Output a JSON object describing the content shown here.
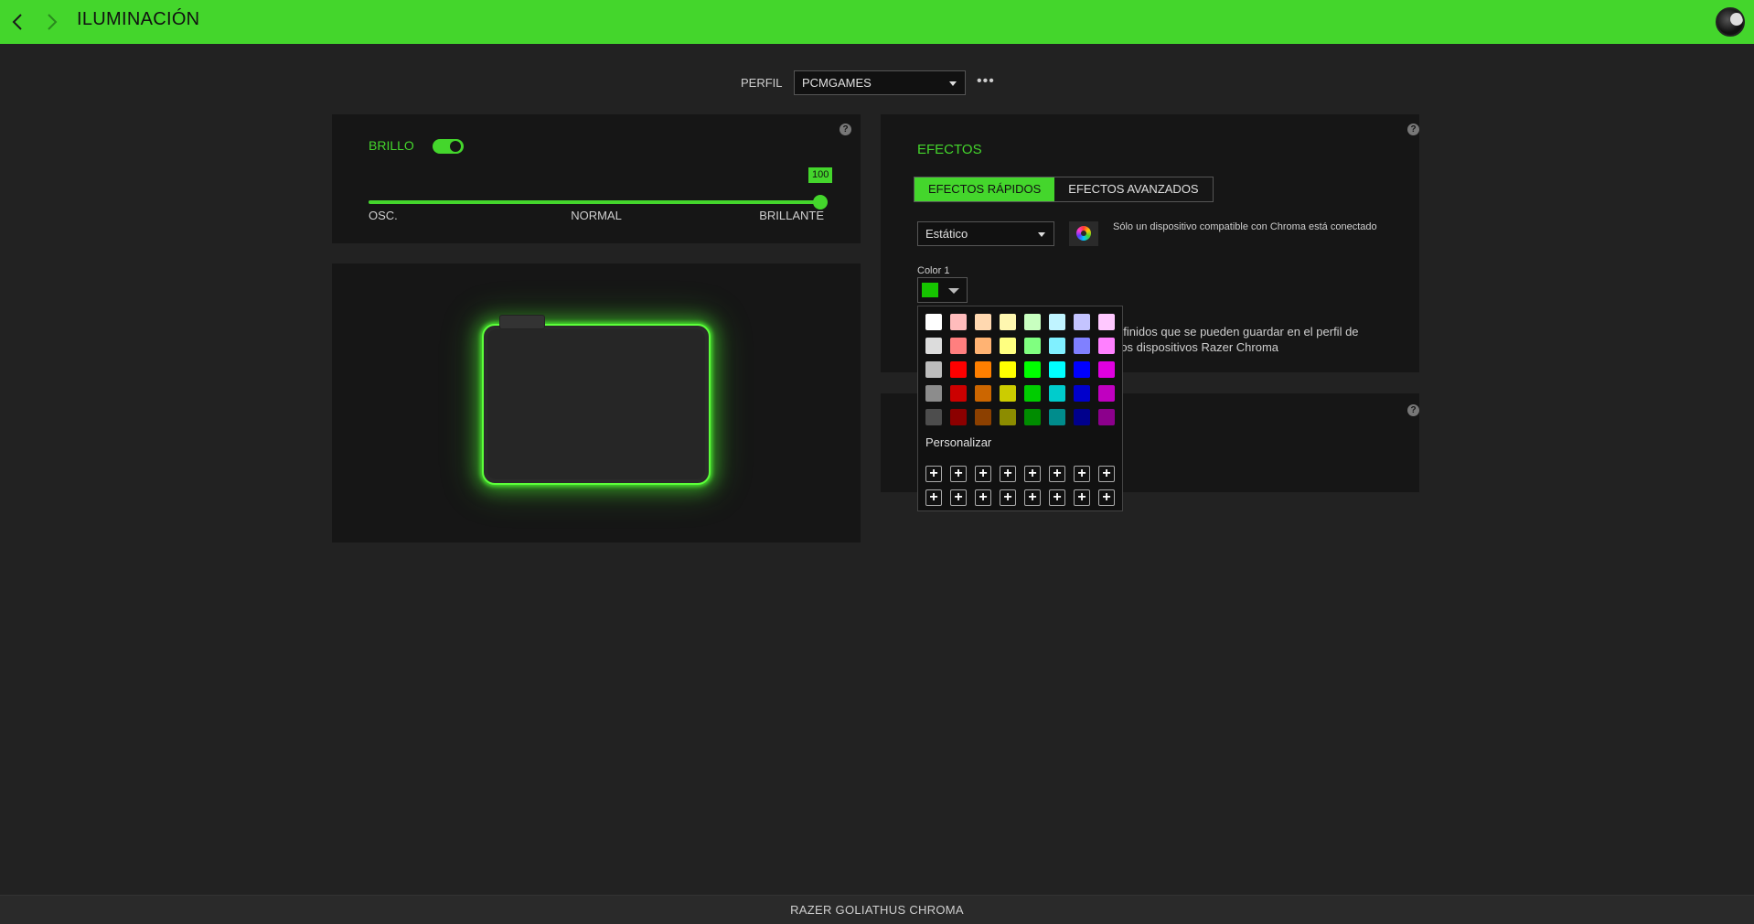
{
  "header": {
    "title": "ILUMINACIÓN"
  },
  "profile": {
    "label": "PERFIL",
    "selected": "PCMGAMES",
    "more": "•••"
  },
  "brightness": {
    "label": "BRILLO",
    "enabled": true,
    "value": "100",
    "value_fraction": 1.0,
    "labels": [
      "OSC.",
      "NORMAL",
      "BRILLANTE"
    ]
  },
  "effects": {
    "title": "EFECTOS",
    "tabs": [
      {
        "label": "EFECTOS RÁPIDOS",
        "active": true
      },
      {
        "label": "EFECTOS AVANZADOS",
        "active": false
      }
    ],
    "selected_effect": "Estático",
    "chroma_note": "Sólo un dispositivo compatible con Chroma está conectado",
    "color_label": "Color 1",
    "current_color": "#16c500",
    "info_line1": "efinidos que se pueden guardar en el perfil de",
    "info_line2": "ros dispositivos Razer Chroma"
  },
  "palette": {
    "colors": [
      "#ffffff",
      "#ffbcbc",
      "#ffd8b0",
      "#fff7b0",
      "#c8ffc0",
      "#c0f4ff",
      "#c4c4ff",
      "#ffc8ff",
      "#dcdcdc",
      "#ff7f7f",
      "#ffb373",
      "#ffff80",
      "#80ff80",
      "#80f0ff",
      "#8080ff",
      "#ff80ff",
      "#bdbdbd",
      "#ff0000",
      "#ff7f00",
      "#ffff00",
      "#00ff00",
      "#00ffff",
      "#0000ff",
      "#e000e0",
      "#8c8c8c",
      "#cc0000",
      "#cc6600",
      "#cccc00",
      "#00cc00",
      "#00cccc",
      "#0000cc",
      "#c000c0",
      "#4d4d4d",
      "#8c0000",
      "#8c4000",
      "#8c8c00",
      "#008c00",
      "#008c8c",
      "#00008c",
      "#8c008c"
    ],
    "custom_label": "Personalizar",
    "custom_slots": 16,
    "plus": "+"
  },
  "footer": {
    "device": "RAZER GOLIATHUS CHROMA"
  },
  "colors": {
    "accent": "#44d62c",
    "background": "#222222",
    "panel": "#161616"
  }
}
